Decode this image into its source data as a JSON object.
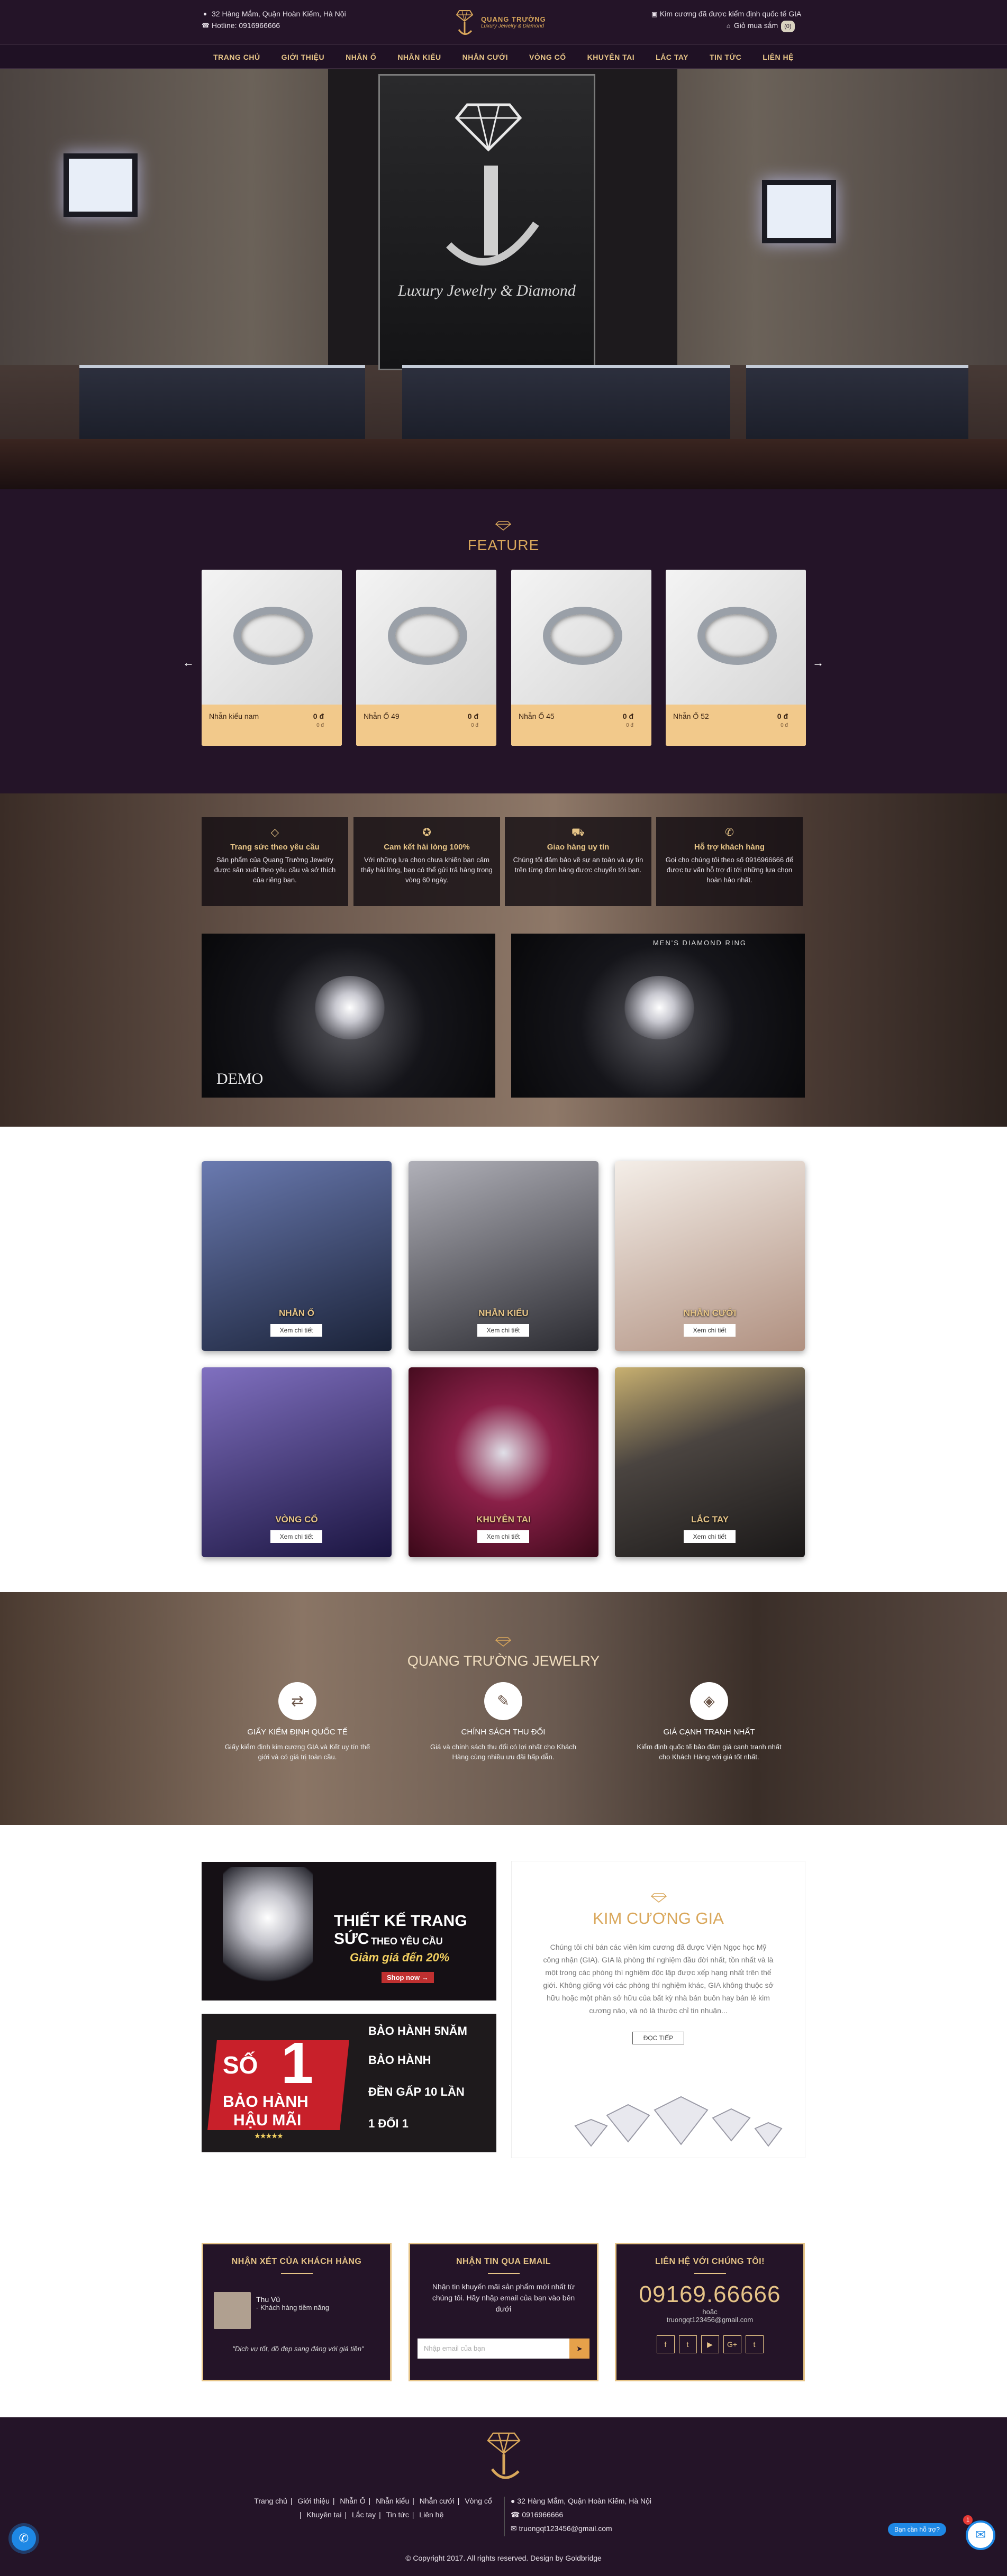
{
  "header": {
    "address": "32 Hàng Mắm, Quận Hoàn Kiếm, Hà Nội",
    "hotline": "Hotline: 0916966666",
    "brand_name": "QUANG TRƯỜNG",
    "brand_sub": "Luxury Jewelry & Diamond",
    "gia_note": "Kim cương đã được kiểm định quốc tế GIA",
    "cart_label": "Giỏ mua sắm",
    "cart_count": "(0)"
  },
  "nav": [
    "TRANG CHỦ",
    "GIỚI THIỆU",
    "NHẪN Ố",
    "NHẪN KIỂU",
    "NHẪN CƯỚI",
    "VÒNG CỔ",
    "KHUYÊN TAI",
    "LẮC TAY",
    "TIN TỨC",
    "LIÊN HỆ"
  ],
  "hero": {
    "sign_text": "Luxury Jewelry & Diamond"
  },
  "feature": {
    "title": "FEATURE",
    "prev": "←",
    "next": "→",
    "products": [
      {
        "name": "Nhẫn kiểu nam",
        "price": "0 đ",
        "sub": "0 đ"
      },
      {
        "name": "Nhẫn Ố 49",
        "price": "0 đ",
        "sub": "0 đ"
      },
      {
        "name": "Nhẫn Ố 45",
        "price": "0 đ",
        "sub": "0 đ"
      },
      {
        "name": "Nhẫn Ố 52",
        "price": "0 đ",
        "sub": "0 đ"
      }
    ]
  },
  "services": [
    {
      "icon": "diamond-icon",
      "title": "Trang sức theo yêu cầu",
      "desc": "Sản phẩm của Quang Trường Jewelry được sản xuất theo yêu cầu và sở thích của riêng bạn."
    },
    {
      "icon": "medal-icon",
      "title": "Cam kết hài lòng 100%",
      "desc": "Với những lựa chọn chưa khiến bạn cảm thấy hài lòng, bạn có thể gửi trả hàng trong vòng 60 ngày."
    },
    {
      "icon": "truck-icon",
      "title": "Giao hàng uy tín",
      "desc": "Chúng tôi đảm bảo về sự an toàn và uy tín trên từng đơn hàng được chuyển tới bạn."
    },
    {
      "icon": "support-icon",
      "title": "Hỗ trợ khách hàng",
      "desc": "Gọi cho chúng tôi theo số 0916966666 để được tư vấn hỗ trợ đi tới những lựa chọn hoàn hảo nhất."
    }
  ],
  "demo": {
    "label": "DEMO",
    "caption": "MEN'S DIAMOND RING"
  },
  "categories": [
    {
      "name": "NHẪN Ố",
      "button": "Xem chi tiết",
      "color": "#3a4a6a"
    },
    {
      "name": "NHẪN KIỂU",
      "button": "Xem chi tiết",
      "color": "#6a6a70"
    },
    {
      "name": "NHẪN CƯỚI",
      "button": "Xem chi tiết",
      "color": "#d8d0c8"
    },
    {
      "name": "VÒNG CỔ",
      "button": "Xem chi tiết",
      "color": "#3a3260"
    },
    {
      "name": "KHUYÊN TAI",
      "button": "Xem chi tiết",
      "color": "#6a1838"
    },
    {
      "name": "LẮC TAY",
      "button": "Xem chi tiết",
      "color": "#504840"
    }
  ],
  "about": {
    "title": "QUANG TRƯỜNG JEWELRY",
    "features": [
      {
        "icon": "exchange-icon",
        "title": "GIẤY KIỂM ĐỊNH QUỐC TẾ",
        "desc": "Giấy kiểm định kim cương GIA và Kết uy tín thế giới và có giá trị toàn cầu."
      },
      {
        "icon": "pen-icon",
        "title": "CHÍNH SÁCH THU ĐỔI",
        "desc": "Giá và chính sách thu đổi có lợi nhất cho Khách Hàng cùng nhiều ưu đãi hấp dẫn."
      },
      {
        "icon": "tag-icon",
        "title": "GIÁ CẠNH TRANH NHẤT",
        "desc": "Kiểm định quốc tế bảo đảm giá cạnh tranh nhất cho Khách Hàng với giá tốt nhất."
      }
    ]
  },
  "banner1": {
    "line1": "THIẾT KẾ TRANG SỨC",
    "line2": "THEO YÊU CẦU",
    "line3": "Giảm giá đến 20%",
    "button": "Shop now →"
  },
  "banner2": {
    "big": "SỐ",
    "one": "1",
    "sub1": "BẢO HÀNH",
    "sub2": "HẬU MÃI",
    "stars": "★★★★★",
    "items": [
      "BẢO HÀNH 5NĂM",
      "BẢO HÀNH",
      "ĐỀN GẤP 10 LẦN",
      "1 ĐỔI 1"
    ]
  },
  "kim": {
    "title": "KIM CƯƠNG GIA",
    "desc": "Chúng tôi chỉ bán các viên kim cương đã được Viện Ngọc học Mỹ công nhận (GIA). GIA là phòng thí nghiệm đầu đời nhất, tồn nhất và là một trong các phòng thí nghiệm độc lập được xếp hạng nhất trên thế giới. Không giống với các phòng thí nghiệm khác, GIA không thuộc sở hữu hoặc một phần sở hữu của bất kỳ nhà bán buôn hay bán lẻ kim cương nào, và nó là thước chỉ tin nhuận...",
    "button": "ĐỌC TIẾP"
  },
  "reviews": {
    "title": "NHẬN XÉT CỦA KHÁCH HÀNG",
    "name": "Thu Vũ",
    "role": "- Khách hàng tiềm năng",
    "quote": "\"Dịch vụ tốt, đồ đẹp sang đáng với giá tiền\""
  },
  "newsletter": {
    "title": "NHẬN TIN QUA EMAIL",
    "text": "Nhận tin khuyến mãi sản phẩm mới nhất từ chúng tôi. Hãy nhập email của bạn vào bên dưới",
    "placeholder": "Nhập email của bạn",
    "button": "➤"
  },
  "contact": {
    "title": "LIÊN HỆ VỚI CHÚNG TÔI!",
    "phone": "09169.66666",
    "or": "hoặc",
    "email": "truongqt123456@gmail.com",
    "socials": [
      "f",
      "t",
      "▶",
      "G+",
      "t"
    ]
  },
  "footer": {
    "links": [
      "Trang chủ",
      "Giới thiệu",
      "Nhẫn Ố",
      "Nhẫn kiểu",
      "Nhẫn cưới",
      "Vòng cổ",
      "Khuyên tai",
      "Lắc tay",
      "Tin tức",
      "Liên hệ"
    ],
    "address": "32 Hàng Mắm, Quận Hoàn Kiếm, Hà Nội",
    "phone": "0916966666",
    "email": "truongqt123456@gmail.com",
    "copyright": "© Copyright 2017. All rights reserved. Design by Goldbridge"
  },
  "chat": {
    "tip": "Bạn cần hỗ trợ?",
    "badge": "1"
  },
  "colors": {
    "brand": "#241428",
    "gold": "#d9a75b",
    "accent": "#e6c487",
    "cream": "#f2c98b"
  }
}
